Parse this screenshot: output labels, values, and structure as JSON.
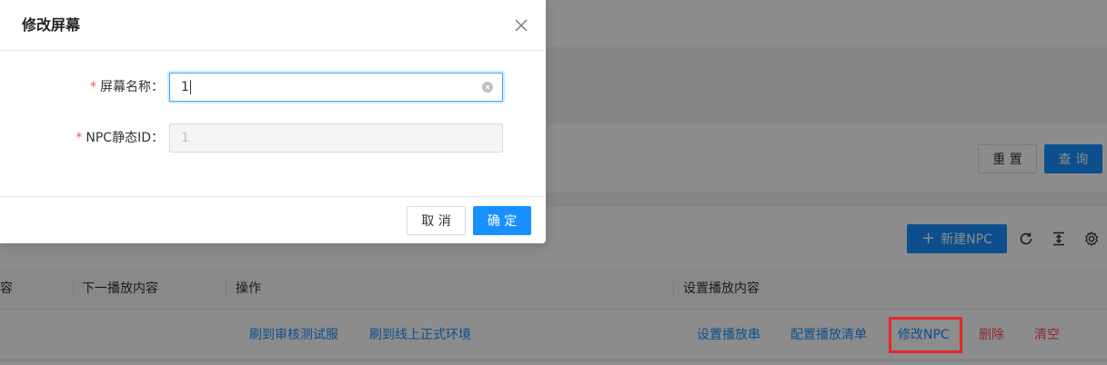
{
  "modal": {
    "title": "修改屏幕",
    "fields": [
      {
        "label": "屏幕名称",
        "colon": "：",
        "required_mark": "*",
        "value": "1"
      },
      {
        "label": "NPC静态ID",
        "colon": "：",
        "required_mark": "*",
        "value": "1"
      }
    ],
    "cancel_label": "取 消",
    "ok_label": "确 定"
  },
  "search": {
    "reset_label": "重 置",
    "query_label": "查 询"
  },
  "toolbar": {
    "new_npc_label": "新建NPC",
    "new_npc_icon": "plus-icon",
    "icons": [
      "reload-icon",
      "column-height-icon",
      "setting-icon"
    ]
  },
  "table": {
    "columns": [
      "容",
      "下一播放内容",
      "操作",
      "设置播放内容"
    ],
    "row": {
      "ops": [
        "刷到审核测试服",
        "刷到线上正式环境"
      ],
      "settings": [
        "设置播放串",
        "配置播放清单",
        "修改NPC",
        "删除",
        "清空"
      ]
    }
  },
  "colors": {
    "primary": "#1890ff",
    "danger": "#ff4d4f",
    "highlight_box": "#e6262a"
  }
}
